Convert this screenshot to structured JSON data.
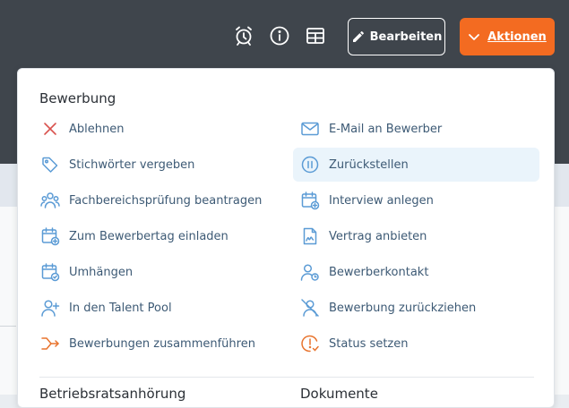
{
  "header": {
    "edit_label": "Bearbeiten",
    "actions_label": "Aktionen",
    "icons": [
      "alarm-clock-icon",
      "info-icon",
      "table-icon"
    ]
  },
  "menu": {
    "title": "Bewerbung",
    "left": [
      {
        "label": "Ablehnen",
        "icon": "close-icon"
      },
      {
        "label": "Stichwörter vergeben",
        "icon": "tag-icon"
      },
      {
        "label": "Fachbereichsprüfung beantragen",
        "icon": "users-icon"
      },
      {
        "label": "Zum Bewerbertag einladen",
        "icon": "calendar-plus-icon"
      },
      {
        "label": "Umhängen",
        "icon": "calendar-check-icon"
      },
      {
        "label": "In den Talent Pool",
        "icon": "user-plus-icon"
      },
      {
        "label": "Bewerbungen zusammenführen",
        "icon": "merge-icon"
      }
    ],
    "right": [
      {
        "label": "E-Mail an Bewerber",
        "icon": "mail-icon"
      },
      {
        "label": "Zurückstellen",
        "icon": "pause-icon",
        "highlighted": true
      },
      {
        "label": "Interview anlegen",
        "icon": "calendar-plus-icon"
      },
      {
        "label": "Vertrag anbieten",
        "icon": "document-icon"
      },
      {
        "label": "Bewerberkontakt",
        "icon": "user-contact-icon"
      },
      {
        "label": "Bewerbung zurückziehen",
        "icon": "user-off-icon"
      },
      {
        "label": "Status setzen",
        "icon": "status-icon"
      }
    ],
    "sections": {
      "betriebsrat": "Betriebsratsanhörung",
      "dokumente": "Dokumente"
    }
  },
  "colors": {
    "accent": "#f36b21",
    "topbar": "#3f454c",
    "icon_blue": "#5b9bd5",
    "close_red": "#d9534f",
    "highlight": "#eaf4fb"
  }
}
